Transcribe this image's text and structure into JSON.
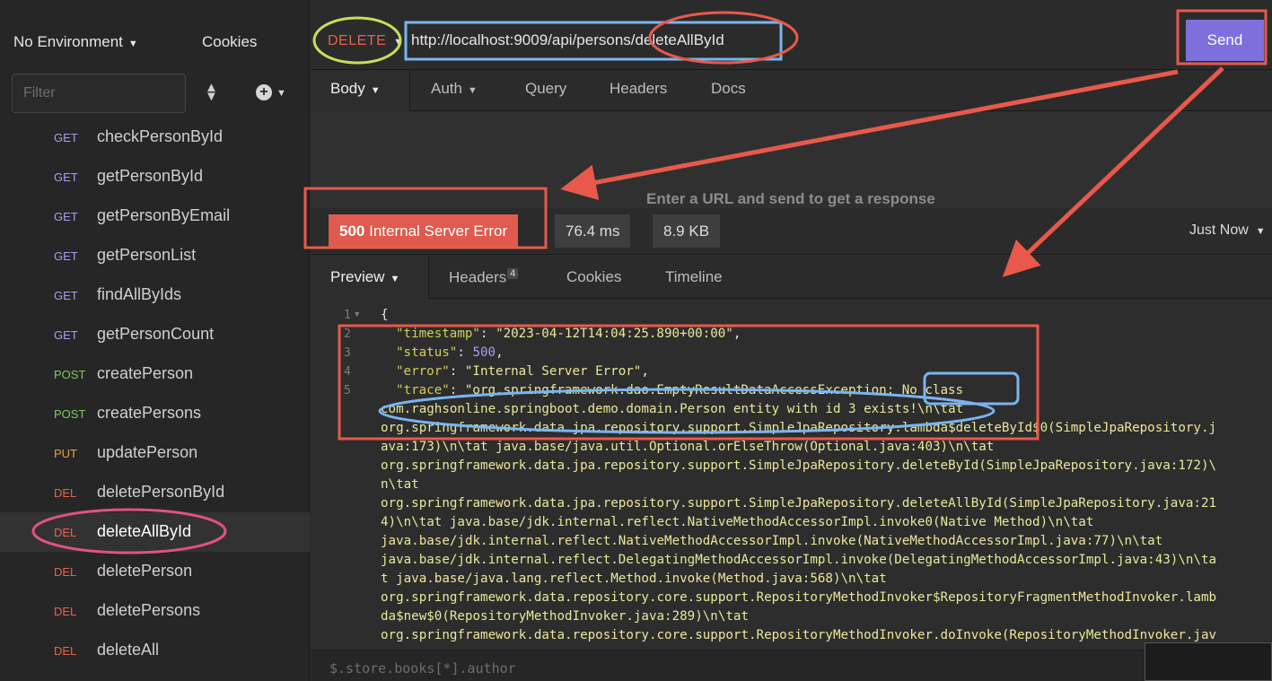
{
  "sidebar": {
    "environment": "No Environment",
    "cookies": "Cookies",
    "filter_placeholder": "Filter",
    "requests": [
      {
        "method": "GET",
        "name": "checkPersonById"
      },
      {
        "method": "GET",
        "name": "getPersonById"
      },
      {
        "method": "GET",
        "name": "getPersonByEmail"
      },
      {
        "method": "GET",
        "name": "getPersonList"
      },
      {
        "method": "GET",
        "name": "findAllByIds"
      },
      {
        "method": "GET",
        "name": "getPersonCount"
      },
      {
        "method": "POST",
        "name": "createPerson"
      },
      {
        "method": "POST",
        "name": "createPersons"
      },
      {
        "method": "PUT",
        "name": "updatePerson"
      },
      {
        "method": "DEL",
        "name": "deletePersonById"
      },
      {
        "method": "DEL",
        "name": "deleteAllById"
      },
      {
        "method": "DEL",
        "name": "deletePerson"
      },
      {
        "method": "DEL",
        "name": "deletePersons"
      },
      {
        "method": "DEL",
        "name": "deleteAll"
      }
    ],
    "active_request": "deleteAllById"
  },
  "request": {
    "method": "DELETE",
    "url": "http://localhost:9009/api/persons/deleteAllById",
    "send_label": "Send",
    "tabs": [
      "Body",
      "Auth",
      "Query",
      "Headers",
      "Docs"
    ],
    "hint": "Enter a URL and send to get a response"
  },
  "response": {
    "status_code": "500",
    "status_text": "Internal Server Error",
    "time": "76.4 ms",
    "size": "8.9 KB",
    "when": "Just Now",
    "tabs": [
      "Preview",
      "Headers",
      "Cookies",
      "Timeline"
    ],
    "headers_count": "4",
    "line_numbers": [
      "1",
      "2",
      "3",
      "4",
      "5"
    ],
    "json": {
      "open": "{",
      "timestamp_key": "\"timestamp\"",
      "timestamp_val": "\"2023-04-12T14:04:25.890+00:00\"",
      "status_key": "\"status\"",
      "status_val": "500",
      "error_key": "\"error\"",
      "error_val": "\"Internal Server Error\"",
      "trace_key": "\"trace\"",
      "trace_first": "\"org.springframework.dao.EmptyResultDataAccessException: No class",
      "trace_lines": [
        "com.raghsonline.springboot.demo.domain.Person entity with id 3 exists!\\n\\tat",
        "org.springframework.data.jpa.repository.support.SimpleJpaRepository.lambda$deleteById$0(SimpleJpaRepository.j",
        "ava:173)\\n\\tat java.base/java.util.Optional.orElseThrow(Optional.java:403)\\n\\tat",
        "org.springframework.data.jpa.repository.support.SimpleJpaRepository.deleteById(SimpleJpaRepository.java:172)\\",
        "n\\tat",
        "org.springframework.data.jpa.repository.support.SimpleJpaRepository.deleteAllById(SimpleJpaRepository.java:21",
        "4)\\n\\tat java.base/jdk.internal.reflect.NativeMethodAccessorImpl.invoke0(Native Method)\\n\\tat",
        "java.base/jdk.internal.reflect.NativeMethodAccessorImpl.invoke(NativeMethodAccessorImpl.java:77)\\n\\tat",
        "java.base/jdk.internal.reflect.DelegatingMethodAccessorImpl.invoke(DelegatingMethodAccessorImpl.java:43)\\n\\ta",
        "t java.base/java.lang.reflect.Method.invoke(Method.java:568)\\n\\tat",
        "org.springframework.data.repository.core.support.RepositoryMethodInvoker$RepositoryFragmentMethodInvoker.lamb",
        "da$new$0(RepositoryMethodInvoker.java:289)\\n\\tat",
        "org.springframework.data.repository.core.support.RepositoryMethodInvoker.doInvoke(RepositoryMethodInvoker.jav"
      ]
    },
    "filter_placeholder": "$.store.books[*].author"
  },
  "colors": {
    "send": "#7d6fdc",
    "error_badge": "#e05a4d",
    "get": "#a99cf5",
    "post": "#7fc75f",
    "put": "#e3a23e",
    "del": "#e8624f",
    "annotation_red": "#e8594b",
    "annotation_blue": "#7ab4f0",
    "annotation_green": "#c6df5a",
    "annotation_pink": "#e0527f"
  },
  "icons": [
    "chevron-down-icon",
    "sort-icon",
    "plus-circle-icon",
    "arrow-annotation"
  ]
}
